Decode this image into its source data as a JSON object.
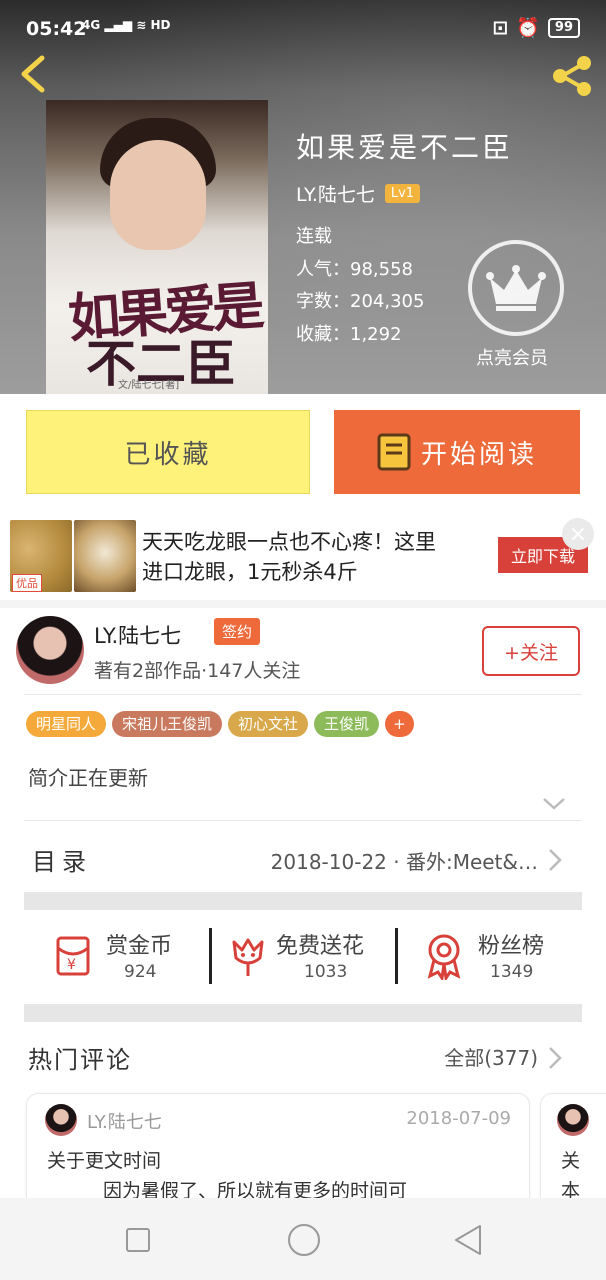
{
  "status_bar": {
    "time": "05:42",
    "signal": "4G",
    "hd": "HD",
    "battery": "99"
  },
  "book": {
    "title": "如果爱是不二臣",
    "author": "LY.陆七七",
    "level": "Lv1",
    "status": "连载",
    "popularity": "人气：98,558",
    "word_count": "字数：204,305",
    "favorites": "收藏：1,292",
    "cover_title_line1": "如果爱是",
    "cover_title_line2": "不二臣",
    "cover_small_text": "文/陆七七[著]"
  },
  "vip": {
    "label": "点亮会员"
  },
  "actions": {
    "collected": "已收藏",
    "start_reading": "开始阅读"
  },
  "ad": {
    "badge": "优品",
    "text_line1": "天天吃龙眼一点也不心疼！这里",
    "text_line2": "进口龙眼，1元秒杀4斤",
    "cta": "立即下载",
    "close": "×"
  },
  "author_card": {
    "name": "LY.陆七七",
    "contract": "签约",
    "stats": "著有2部作品·147人关注",
    "follow": "+关注"
  },
  "tags": [
    {
      "label": "明星同人",
      "color": "#f4a93a"
    },
    {
      "label": "宋祖儿王俊凯",
      "color": "#c97a5e"
    },
    {
      "label": "初心文社",
      "color": "#d8a84a"
    },
    {
      "label": "王俊凯",
      "color": "#8dbb5a"
    },
    {
      "label": "+",
      "color": "#ee6a3a"
    }
  ],
  "intro": {
    "text": "简介正在更新"
  },
  "toc": {
    "label": "目录",
    "latest": "2018-10-22 · 番外:Meet&…"
  },
  "rewards": [
    {
      "label": "赏金币",
      "value": "924",
      "icon": "red-envelope-icon"
    },
    {
      "label": "免费送花",
      "value": "1033",
      "icon": "flower-icon"
    },
    {
      "label": "粉丝榜",
      "value": "1349",
      "icon": "medal-icon"
    }
  ],
  "comments": {
    "title": "热门评论",
    "all": "全部(377)",
    "items": [
      {
        "user": "LY.陆七七",
        "date": "2018-07-09",
        "subject": "关于更文时间",
        "body": "因为暑假了、所以就有更多的时间可"
      }
    ],
    "peek": {
      "line1": "关",
      "line2": "本"
    }
  },
  "colors": {
    "accent": "#ee6a3a",
    "yellow_btn": "#fff27a",
    "red": "#e04b3a"
  }
}
